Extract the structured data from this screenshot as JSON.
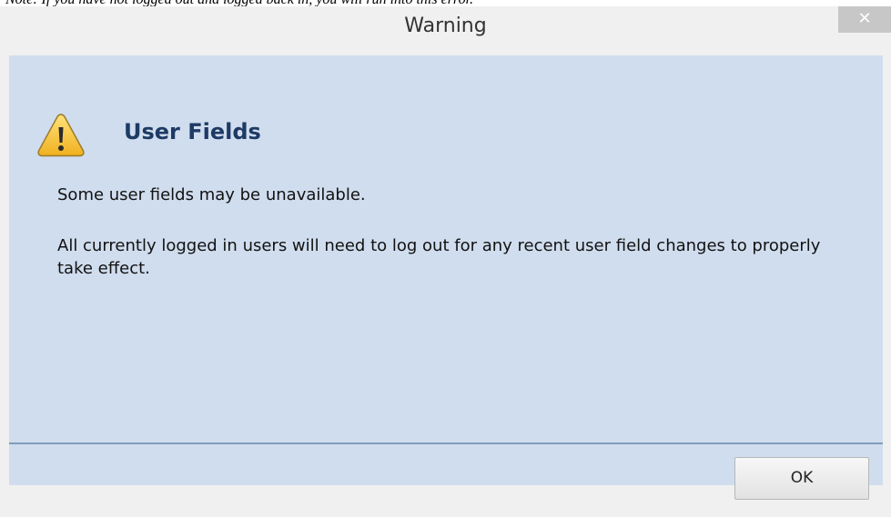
{
  "page": {
    "note_text": "Note: If you have not logged out and logged back in, you will run into this error."
  },
  "dialog": {
    "title": "Warning",
    "close_glyph": "✕",
    "icon": "warning-icon",
    "heading": "User Fields",
    "message_line_1": "Some user fields may be unavailable.",
    "message_line_2": "All currently logged in users will need to log out for any recent user field changes to properly take effect.",
    "ok_label": "OK"
  },
  "colors": {
    "content_background": "#d0ddee",
    "heading": "#1e3a64",
    "titlebar": "#f0f0f0",
    "close_button": "#c7c7c7",
    "separator": "#7f9db9",
    "warning_fill": "#f7c531"
  }
}
